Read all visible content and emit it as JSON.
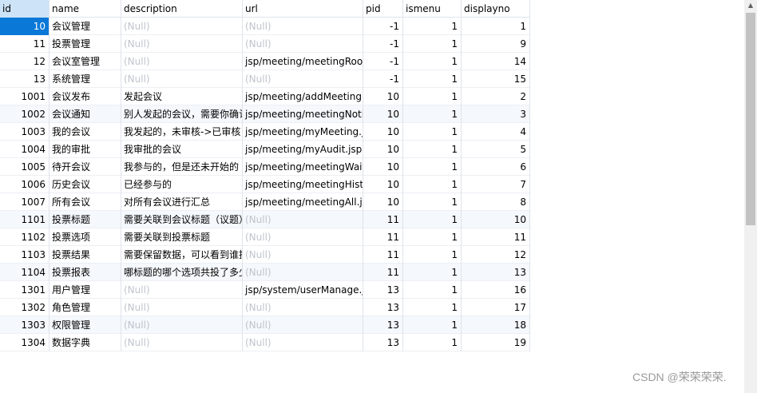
{
  "columns": [
    "id",
    "name",
    "description",
    "url",
    "pid",
    "ismenu",
    "displayno"
  ],
  "rows": [
    {
      "id": "10",
      "name": "会议管理",
      "description": "(Null)",
      "url": "(Null)",
      "pid": "-1",
      "ismenu": "1",
      "displayno": "1"
    },
    {
      "id": "11",
      "name": "投票管理",
      "description": "(Null)",
      "url": "(Null)",
      "pid": "-1",
      "ismenu": "1",
      "displayno": "9"
    },
    {
      "id": "12",
      "name": "会议室管理",
      "description": "(Null)",
      "url": "jsp/meeting/meetingRoor",
      "pid": "-1",
      "ismenu": "1",
      "displayno": "14"
    },
    {
      "id": "13",
      "name": "系统管理",
      "description": "(Null)",
      "url": "(Null)",
      "pid": "-1",
      "ismenu": "1",
      "displayno": "15"
    },
    {
      "id": "1001",
      "name": "会议发布",
      "description": "发起会议",
      "url": "jsp/meeting/addMeeting.",
      "pid": "10",
      "ismenu": "1",
      "displayno": "2"
    },
    {
      "id": "1002",
      "name": "会议通知",
      "description": "别人发起的会议，需要你确认",
      "url": "jsp/meeting/meetingNoti",
      "pid": "10",
      "ismenu": "1",
      "displayno": "3"
    },
    {
      "id": "1003",
      "name": "我的会议",
      "description": "我发起的，未审核->已审核",
      "url": "jsp/meeting/myMeeting.js",
      "pid": "10",
      "ismenu": "1",
      "displayno": "4"
    },
    {
      "id": "1004",
      "name": "我的审批",
      "description": "我审批的会议",
      "url": "jsp/meeting/myAudit.jsp",
      "pid": "10",
      "ismenu": "1",
      "displayno": "5"
    },
    {
      "id": "1005",
      "name": "待开会议",
      "description": "我参与的，但是还未开始的",
      "url": "jsp/meeting/meetingWait",
      "pid": "10",
      "ismenu": "1",
      "displayno": "6"
    },
    {
      "id": "1006",
      "name": "历史会议",
      "description": "已经参与的",
      "url": "jsp/meeting/meetingHisto",
      "pid": "10",
      "ismenu": "1",
      "displayno": "7"
    },
    {
      "id": "1007",
      "name": "所有会议",
      "description": "对所有会议进行汇总",
      "url": "jsp/meeting/meetingAll.js",
      "pid": "10",
      "ismenu": "1",
      "displayno": "8"
    },
    {
      "id": "1101",
      "name": "投票标题",
      "description": "需要关联到会议标题（议题）",
      "url": "(Null)",
      "pid": "11",
      "ismenu": "1",
      "displayno": "10"
    },
    {
      "id": "1102",
      "name": "投票选项",
      "description": "需要关联到投票标题",
      "url": "(Null)",
      "pid": "11",
      "ismenu": "1",
      "displayno": "11"
    },
    {
      "id": "1103",
      "name": "投票结果",
      "description": "需要保留数据，可以看到谁投",
      "url": "(Null)",
      "pid": "11",
      "ismenu": "1",
      "displayno": "12"
    },
    {
      "id": "1104",
      "name": "投票报表",
      "description": "哪标题的哪个选项共投了多少",
      "url": "(Null)",
      "pid": "11",
      "ismenu": "1",
      "displayno": "13"
    },
    {
      "id": "1301",
      "name": "用户管理",
      "description": "(Null)",
      "url": "jsp/system/userManage.js",
      "pid": "13",
      "ismenu": "1",
      "displayno": "16"
    },
    {
      "id": "1302",
      "name": "角色管理",
      "description": "(Null)",
      "url": "(Null)",
      "pid": "13",
      "ismenu": "1",
      "displayno": "17"
    },
    {
      "id": "1303",
      "name": "权限管理",
      "description": "(Null)",
      "url": "(Null)",
      "pid": "13",
      "ismenu": "1",
      "displayno": "18"
    },
    {
      "id": "1304",
      "name": "数据字典",
      "description": "(Null)",
      "url": "(Null)",
      "pid": "13",
      "ismenu": "1",
      "displayno": "19"
    }
  ],
  "alt_rows": [
    5,
    11,
    14,
    17
  ],
  "selected_row": 0,
  "watermark": "CSDN @荣荣荣荣."
}
